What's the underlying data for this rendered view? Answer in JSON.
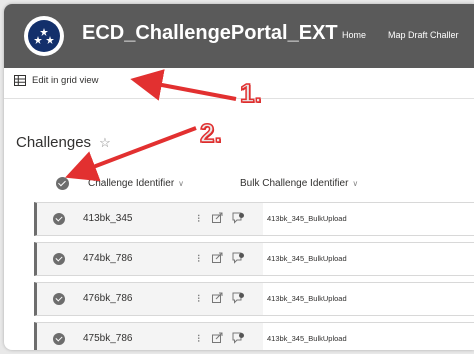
{
  "header": {
    "site_title": "ECD_ChallengePortal_EXT",
    "nav": [
      "Home",
      "Map Draft Challer"
    ]
  },
  "command_bar": {
    "edit_grid_label": "Edit in grid view"
  },
  "list": {
    "title": "Challenges",
    "columns": [
      "Challenge Identifier",
      "Bulk Challenge Identifier"
    ],
    "rows": [
      {
        "id": "413bk_345",
        "bulk": "413bk_345_BulkUpload"
      },
      {
        "id": "474bk_786",
        "bulk": "413bk_345_BulkUpload"
      },
      {
        "id": "476bk_786",
        "bulk": "413bk_345_BulkUpload"
      },
      {
        "id": "475bk_786",
        "bulk": "413bk_345_BulkUpload"
      }
    ]
  },
  "annotations": {
    "step1": "1.",
    "step2": "2."
  },
  "colors": {
    "topbar": "#5a5a5a",
    "arrow": "#e23030",
    "check": "#6d6d6d"
  }
}
